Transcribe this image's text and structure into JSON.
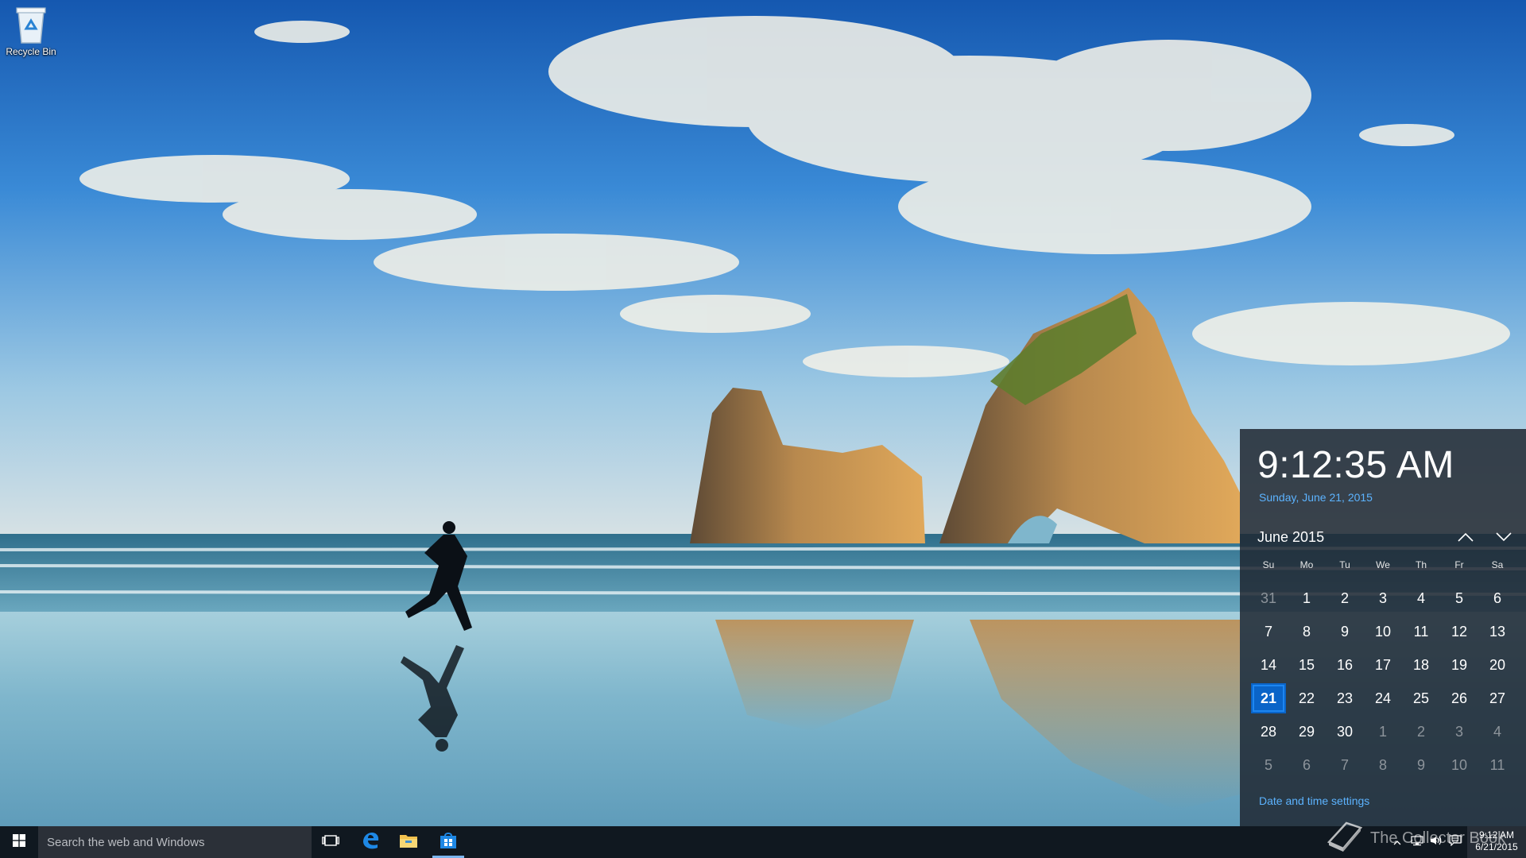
{
  "desktop": {
    "icons": [
      {
        "label": "Recycle Bin",
        "icon": "recycle-bin-icon"
      }
    ]
  },
  "flyout": {
    "time": "9:12:35 AM",
    "long_date": "Sunday, June 21, 2015",
    "month_label": "June 2015",
    "prev_icon": "chevron-up-icon",
    "next_icon": "chevron-down-icon",
    "weekdays": [
      "Su",
      "Mo",
      "Tu",
      "We",
      "Th",
      "Fr",
      "Sa"
    ],
    "days": [
      {
        "n": "31",
        "other": true
      },
      {
        "n": "1"
      },
      {
        "n": "2"
      },
      {
        "n": "3"
      },
      {
        "n": "4"
      },
      {
        "n": "5"
      },
      {
        "n": "6"
      },
      {
        "n": "7"
      },
      {
        "n": "8"
      },
      {
        "n": "9"
      },
      {
        "n": "10"
      },
      {
        "n": "11"
      },
      {
        "n": "12"
      },
      {
        "n": "13"
      },
      {
        "n": "14"
      },
      {
        "n": "15"
      },
      {
        "n": "16"
      },
      {
        "n": "17"
      },
      {
        "n": "18"
      },
      {
        "n": "19"
      },
      {
        "n": "20"
      },
      {
        "n": "21",
        "today": true
      },
      {
        "n": "22"
      },
      {
        "n": "23"
      },
      {
        "n": "24"
      },
      {
        "n": "25"
      },
      {
        "n": "26"
      },
      {
        "n": "27"
      },
      {
        "n": "28"
      },
      {
        "n": "29"
      },
      {
        "n": "30"
      },
      {
        "n": "1",
        "other": true
      },
      {
        "n": "2",
        "other": true
      },
      {
        "n": "3",
        "other": true
      },
      {
        "n": "4",
        "other": true
      },
      {
        "n": "5",
        "other": true
      },
      {
        "n": "6",
        "other": true
      },
      {
        "n": "7",
        "other": true
      },
      {
        "n": "8",
        "other": true
      },
      {
        "n": "9",
        "other": true
      },
      {
        "n": "10",
        "other": true
      },
      {
        "n": "11",
        "other": true
      }
    ],
    "settings_link": "Date and time settings",
    "accent_color": "#0a64c8",
    "link_color": "#5cb3ff"
  },
  "taskbar": {
    "search_placeholder": "Search the web and Windows",
    "start_icon": "windows-logo-icon",
    "pinned": [
      {
        "name": "task-view",
        "icon": "task-view-icon"
      },
      {
        "name": "edge",
        "icon": "edge-browser-icon"
      },
      {
        "name": "file-explorer",
        "icon": "folder-icon"
      },
      {
        "name": "store",
        "icon": "store-bag-icon"
      }
    ],
    "tray_icons": [
      "chevron-up-icon",
      "network-icon",
      "volume-icon",
      "action-center-icon"
    ],
    "clock_time": "9:12 AM",
    "clock_date": "6/21/2015"
  },
  "watermark": {
    "text": "The Collector Book",
    "icon": "book-icon"
  }
}
